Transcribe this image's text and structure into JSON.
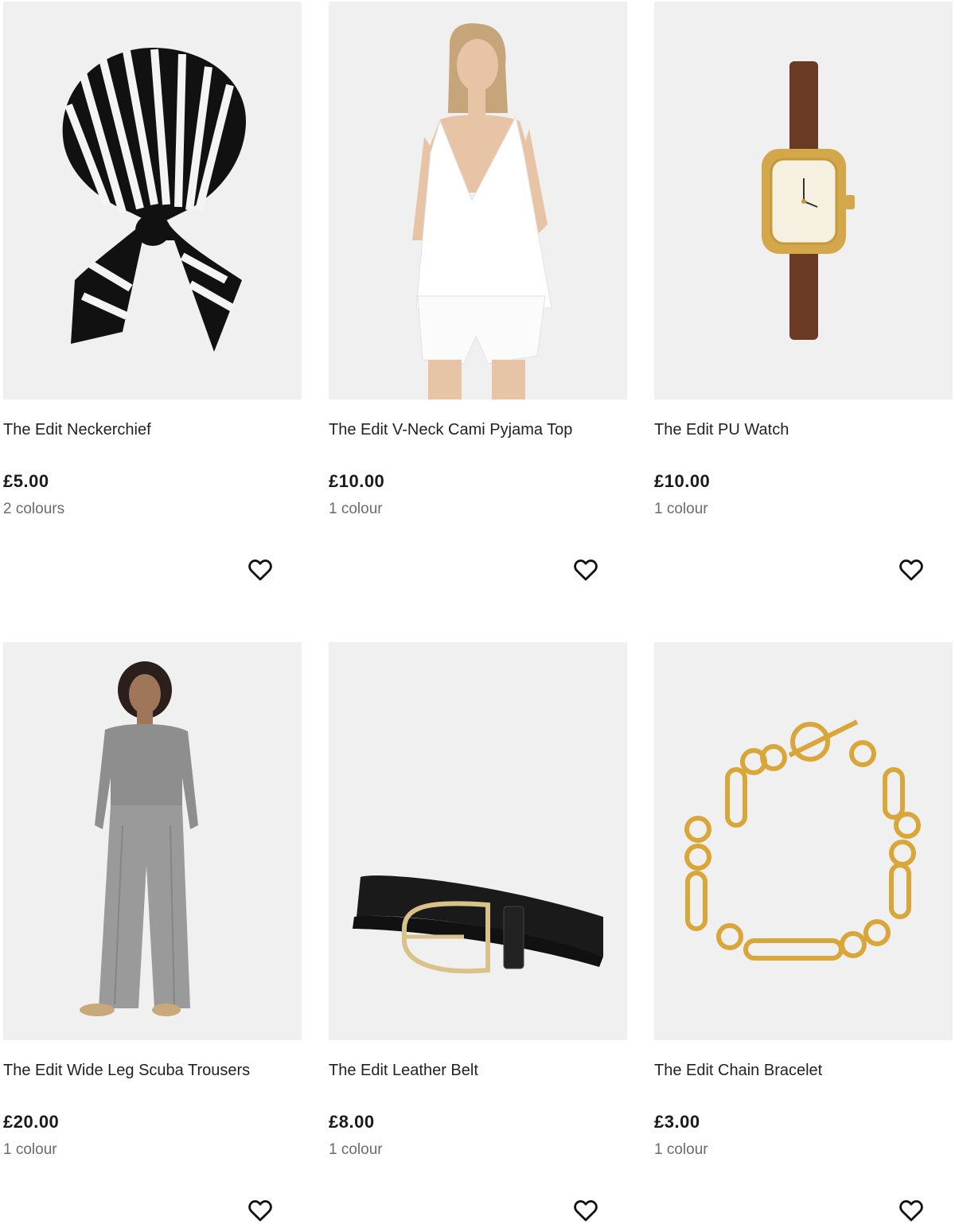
{
  "products": [
    {
      "name": "The Edit Neckerchief",
      "price": "£5.00",
      "colours": "2 colours",
      "image_icon": "neckerchief-image",
      "wishlist_icon": "heart-icon"
    },
    {
      "name": "The Edit V-Neck Cami Pyjama Top",
      "price": "£10.00",
      "colours": "1 colour",
      "image_icon": "cami-top-image",
      "wishlist_icon": "heart-icon"
    },
    {
      "name": "The Edit PU Watch",
      "price": "£10.00",
      "colours": "1 colour",
      "image_icon": "watch-image",
      "wishlist_icon": "heart-icon"
    },
    {
      "name": "The Edit Wide Leg Scuba Trousers",
      "price": "£20.00",
      "colours": "1 colour",
      "image_icon": "trousers-image",
      "wishlist_icon": "heart-icon"
    },
    {
      "name": "The Edit Leather Belt",
      "price": "£8.00",
      "colours": "1 colour",
      "image_icon": "belt-image",
      "wishlist_icon": "heart-icon"
    },
    {
      "name": "The Edit Chain Bracelet",
      "price": "£3.00",
      "colours": "1 colour",
      "image_icon": "bracelet-image",
      "wishlist_icon": "heart-icon"
    }
  ],
  "colors": {
    "image_background": "#f0f0f0",
    "text": "#222222",
    "muted_text": "#6b6b6b"
  }
}
